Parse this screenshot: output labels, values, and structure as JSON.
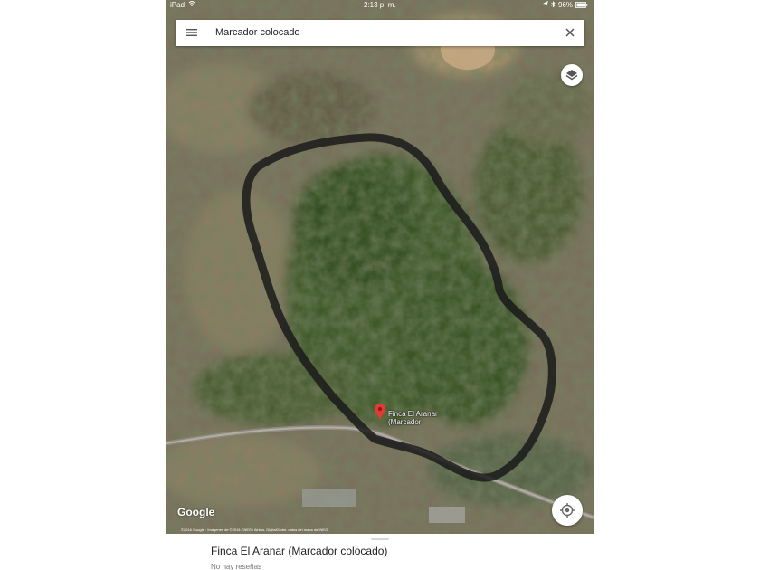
{
  "status_bar": {
    "device": "iPad",
    "time": "2:13 p. m.",
    "battery": "96%"
  },
  "search": {
    "query": "Marcador colocado"
  },
  "map": {
    "place_label_line1": "Finca El Aranar",
    "place_label_line2": "(Marcador",
    "attribution": "Google",
    "copyright": "©2016 Google · Imágenes de ©2016 CNES / Airbus, DigitalGlobe, datos del mapa de INEGI"
  },
  "place_sheet": {
    "title": "Finca El Aranar (Marcador colocado)",
    "reviews": "No hay reseñas"
  },
  "icons": {
    "menu": "menu-icon",
    "close": "close-icon",
    "layers": "layers-icon",
    "pin": "map-pin-icon",
    "location": "my-location-icon",
    "wifi": "wifi-icon",
    "bluetooth": "bluetooth-icon",
    "battery": "battery-icon"
  },
  "colors": {
    "pin": "#e53935",
    "outline": "#1a1a1a"
  }
}
